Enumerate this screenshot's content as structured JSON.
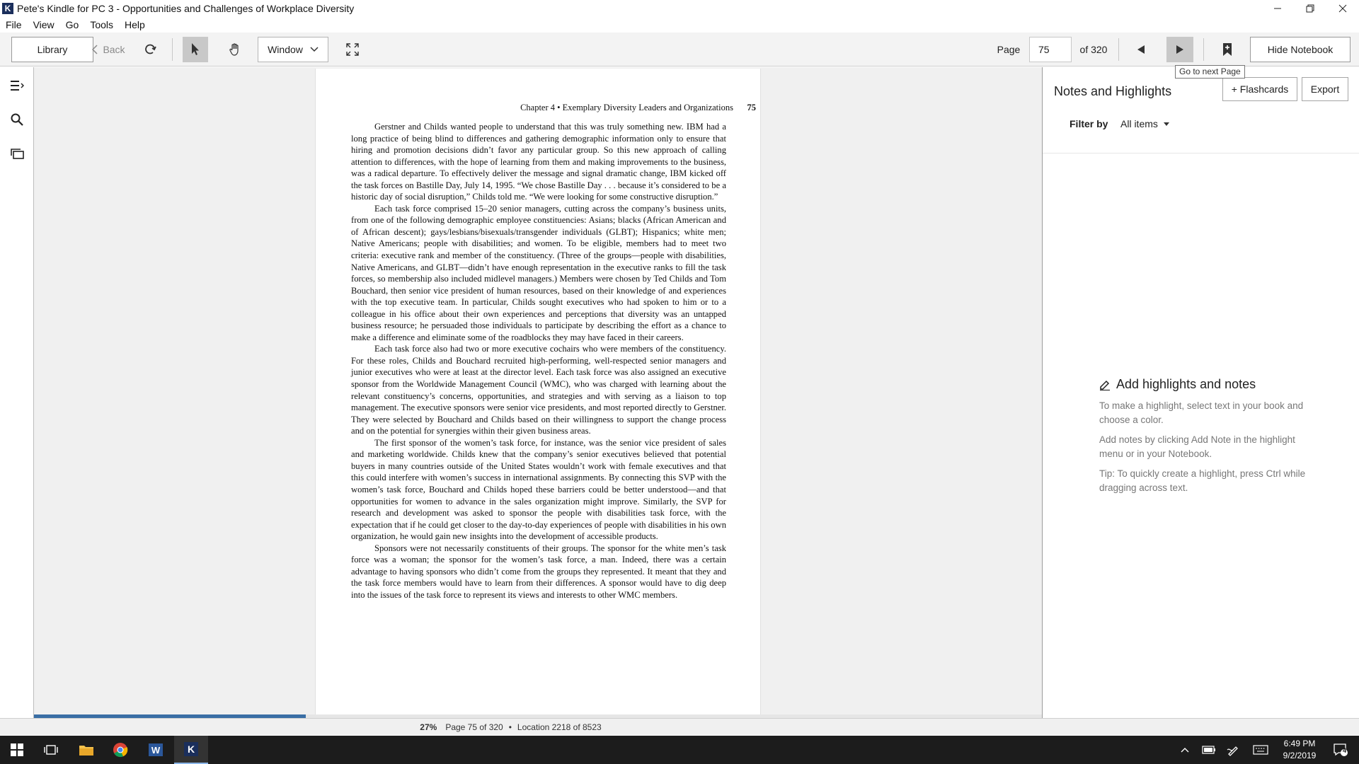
{
  "window": {
    "title": "Pete's Kindle for PC 3 - Opportunities and Challenges of Workplace Diversity",
    "app_icon_letter": "K"
  },
  "menu": [
    "File",
    "View",
    "Go",
    "Tools",
    "Help"
  ],
  "toolbar": {
    "library_label": "Library",
    "back_label": "Back",
    "view_mode": "Window",
    "page_label": "Page",
    "page_value": "75",
    "page_total_label": "of 320",
    "hide_notebook_label": "Hide Notebook",
    "tooltip": "Go to next Page"
  },
  "book": {
    "running_head": "Chapter 4  •  Exemplary Diversity Leaders and Organizations",
    "page_number": "75",
    "paragraphs": [
      "Gerstner and Childs wanted people to understand that this was truly something new. IBM had a long practice of being blind to differences and gathering demographic information only to ensure that hiring and promotion decisions didn’t favor any particular group. So this new approach of calling attention to differences, with the hope of learning from them and making improvements to the business, was a radical departure. To effectively deliver the message and signal dramatic change, IBM kicked off the task forces on Bastille Day, July 14, 1995. “We chose Bastille Day . . . because it’s considered to be a historic day of social disruption,” Childs told me. “We were looking for some constructive disruption.”",
      "Each task force comprised 15–20 senior managers, cutting across the company’s business units, from one of the following demographic employee constituencies: Asians; blacks (African American and of African descent); gays/lesbians/bisexuals/transgender individuals (GLBT); Hispanics; white men; Native Americans; people with disabilities; and women. To be eligible, members had to meet two criteria: executive rank and member of the constituency. (Three of the groups—people with disabilities, Native Americans, and GLBT—didn’t have enough representation in the executive ranks to fill the task forces, so membership also included midlevel managers.) Members were chosen by Ted Childs and Tom Bouchard, then senior vice president of human resources, based on their knowledge of and experiences with the top executive team. In particular, Childs sought executives who had spoken to him or to a colleague in his office about their own experiences and perceptions that diversity was an untapped business resource; he persuaded those individuals to participate by describing the effort as a chance to make a difference and eliminate some of the roadblocks they may have faced in their careers.",
      "Each task force also had two or more executive cochairs who were members of the constituency. For these roles, Childs and Bouchard recruited high-performing, well-respected senior managers and junior executives who were at least at the director level. Each task force was also assigned an executive sponsor from the Worldwide Management Council (WMC), who was charged with learning about the relevant constituency’s concerns, opportunities, and strategies and with serving as a liaison to top management. The executive sponsors were senior vice presidents, and most reported directly to Gerstner. They were selected by Bouchard and Childs based on their willingness to support the change process and on the potential for synergies within their given business areas.",
      "The first sponsor of the women’s task force, for instance, was the senior vice president of sales and marketing worldwide. Childs knew that the company’s senior executives believed that potential buyers in many countries outside of the United States wouldn’t work with female executives and that this could interfere with women’s success in international assignments. By connecting this SVP with the women’s task force, Bouchard and Childs hoped these barriers could be better understood—and that opportunities for women to advance in the sales organization might improve. Similarly, the SVP for research and development was asked to sponsor the people with disabilities task force, with the expectation that if he could get closer to the day-to-day experiences of people with disabilities in his own organization, he would gain new insights into the development of accessible products.",
      "Sponsors were not necessarily constituents of their groups. The sponsor for the white men’s task force was a woman; the sponsor for the women’s task force, a man. Indeed, there was a certain advantage to having sponsors who didn’t come from the groups they represented. It meant that they and the task force members would have to learn from their differences. A sponsor would have to dig deep into the issues of the task force to represent its views and interests to other WMC members."
    ]
  },
  "progress": {
    "fraction": 0.27
  },
  "notebook": {
    "title": "Notes and Highlights",
    "flashcards_label": "+ Flashcards",
    "export_label": "Export",
    "filter_label": "Filter by",
    "filter_value": "All items",
    "empty_title": "Add highlights and notes",
    "empty_p1": "To make a highlight, select text in your book and choose a color.",
    "empty_p2": "Add notes by clicking Add Note in the highlight menu or in your Notebook.",
    "empty_p3": "Tip: To quickly create a highlight, press Ctrl while dragging across text."
  },
  "status": {
    "percent": "27%",
    "page": "Page 75 of 320",
    "location": "Location 2218 of 8523"
  },
  "taskbar": {
    "time": "6:49 PM",
    "date": "9/2/2019",
    "notification_count": "4"
  },
  "icons": {
    "app": "kindle-icon",
    "back": "chevron-left-icon",
    "sync": "sync-icon",
    "select": "pointer-arrow-icon",
    "hand": "hand-icon",
    "fullscreen": "fullscreen-icon",
    "prev": "triangle-left-icon",
    "next": "triangle-right-icon",
    "bookmark": "bookmark-plus-icon",
    "toc": "table-of-contents-icon",
    "search": "search-icon",
    "flashcards_rail": "cards-icon",
    "pencil": "pencil-icon"
  },
  "colors": {
    "accent": "#3a6ea5",
    "toolbar_bg": "#f3f3f3",
    "reading_bg": "#f0f0f0",
    "taskbar_bg": "#1c1c1c"
  }
}
